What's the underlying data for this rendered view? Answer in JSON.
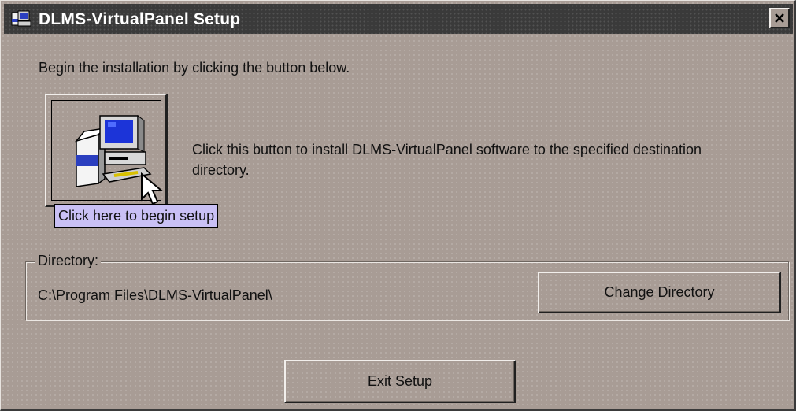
{
  "window": {
    "title": "DLMS-VirtualPanel Setup",
    "close_symbol": "✕"
  },
  "main": {
    "instruction": "Begin the installation by clicking the button below.",
    "setup_description": "Click this button to install DLMS-VirtualPanel software to the specified destination directory.",
    "tooltip": "Click here to begin setup"
  },
  "directory": {
    "group_label": "Directory:",
    "path": "C:\\Program Files\\DLMS-VirtualPanel\\",
    "change_button": {
      "mnemonic": "C",
      "rest": "hange Directory"
    }
  },
  "footer": {
    "exit_button": {
      "before": "E",
      "mnemonic": "x",
      "rest": "it Setup"
    }
  },
  "colors": {
    "dialog_bg": "#a89c95",
    "titlebar": "#3a3a3a",
    "tooltip_bg": "#c9c0f5"
  },
  "icons": [
    "setup-app-icon",
    "computer-setup-icon",
    "mouse-cursor-icon",
    "close-icon"
  ]
}
